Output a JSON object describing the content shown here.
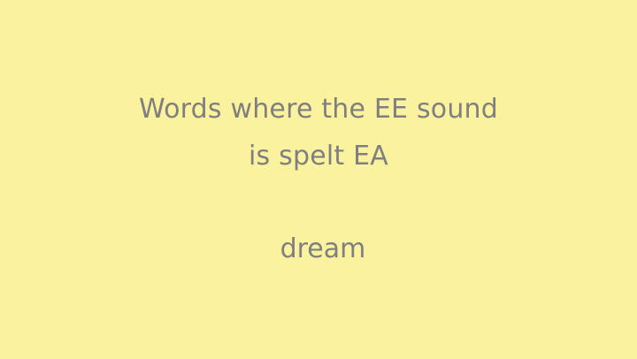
{
  "slide": {
    "title_line_1": "Words where the EE sound",
    "title_line_2": "is spelt EA",
    "word": "dream"
  },
  "colors": {
    "background": "#fbf29f",
    "text": "#7f7f7f"
  }
}
